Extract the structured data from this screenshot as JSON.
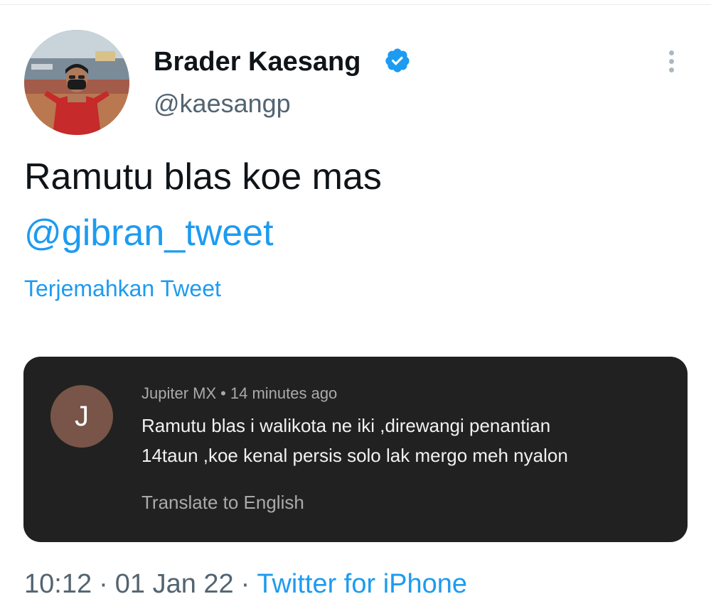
{
  "tweet": {
    "author": {
      "display_name": "Brader Kaesang",
      "handle": "@kaesangp",
      "verified": true,
      "verified_icon": "verified-badge-icon"
    },
    "text": "Ramutu blas koe mas",
    "mention": "@gibran_tweet",
    "translate_label": "Terjemahkan Tweet",
    "more_icon": "more-options-icon",
    "embedded_comment": {
      "avatar_letter": "J",
      "author": "Jupiter MX",
      "time": "14 minutes ago",
      "text_line1": "Ramutu blas i walikota ne iki ,direwangi penantian",
      "text_line2": "14taun ,koe kenal persis solo lak mergo meh nyalon",
      "translate_label": "Translate to English"
    },
    "footer": {
      "time": "10:12",
      "date": "01 Jan 22",
      "source": "Twitter for iPhone",
      "separator": "·"
    }
  },
  "colors": {
    "accent": "#1d9bf0",
    "text_primary": "#0f1419",
    "text_secondary": "#536471",
    "card_background": "#212121",
    "card_avatar": "#785548"
  }
}
